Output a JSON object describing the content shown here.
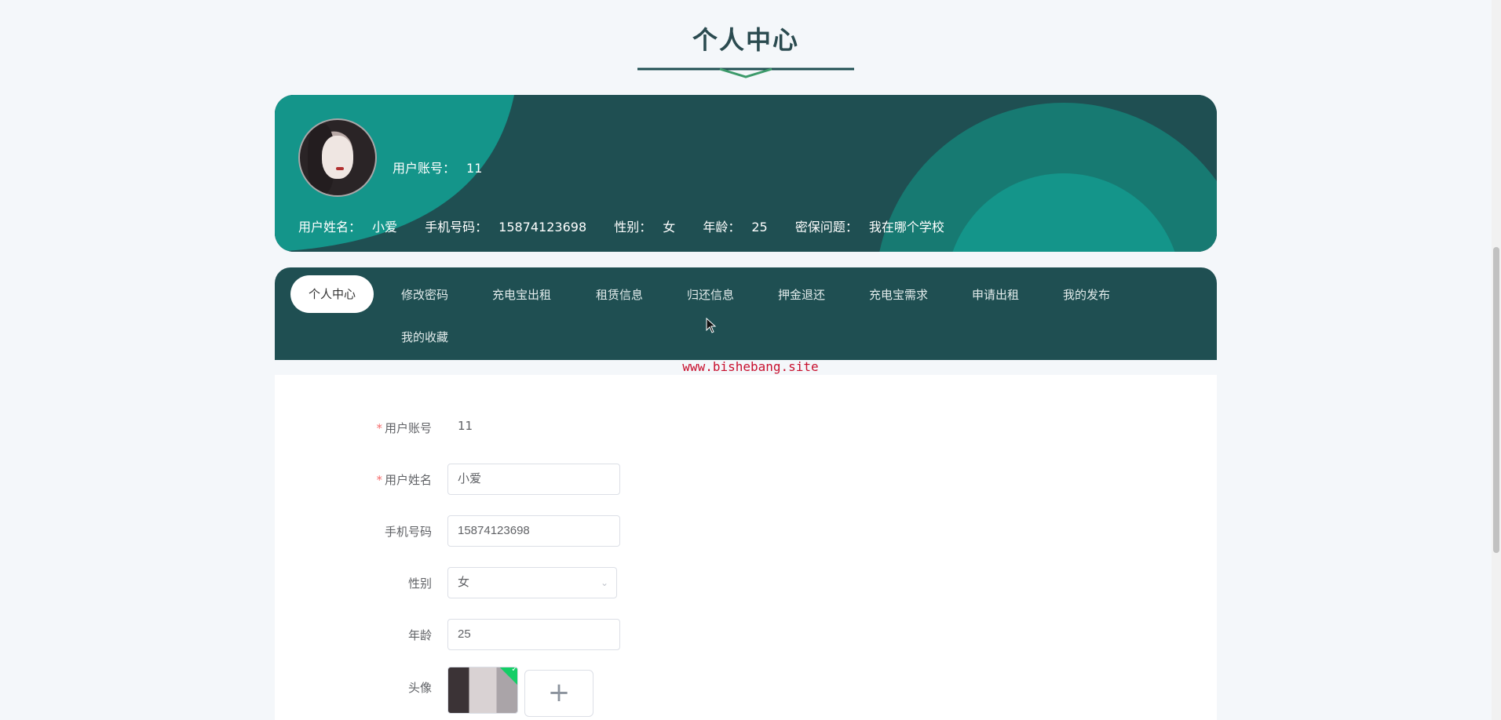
{
  "page_title": "个人中心",
  "colors": {
    "accent": "#1f4f52",
    "teal": "#14958a",
    "required": "#f56c6c",
    "watermark": "#c8102e"
  },
  "profile": {
    "account_label": "用户账号：",
    "account_value": "11",
    "fields": [
      {
        "label": "用户姓名：",
        "value": "小爱"
      },
      {
        "label": "手机号码：",
        "value": "15874123698"
      },
      {
        "label": "性别：",
        "value": "女"
      },
      {
        "label": "年龄：",
        "value": "25"
      },
      {
        "label": "密保问题：",
        "value": "我在哪个学校"
      }
    ]
  },
  "nav": {
    "items": [
      "个人中心",
      "修改密码",
      "充电宝出租",
      "租赁信息",
      "归还信息",
      "押金退还",
      "充电宝需求",
      "申请出租",
      "我的发布",
      "我的收藏"
    ],
    "active": "个人中心"
  },
  "watermark": "www.bishebang.site",
  "form": {
    "required_mark": "*",
    "account": {
      "label": "用户账号",
      "value": "11"
    },
    "name": {
      "label": "用户姓名",
      "value": "小爱"
    },
    "phone": {
      "label": "手机号码",
      "value": "15874123698"
    },
    "gender": {
      "label": "性别",
      "value": "女"
    },
    "age": {
      "label": "年龄",
      "value": "25"
    },
    "avatar": {
      "label": "头像",
      "add_icon": "plus-icon"
    }
  }
}
